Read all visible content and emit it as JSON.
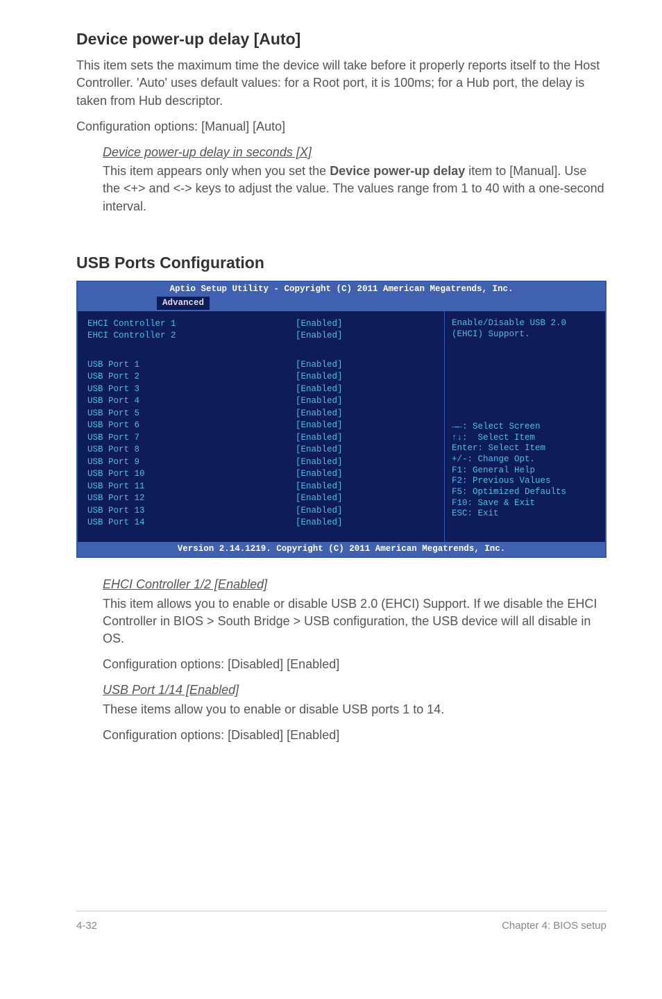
{
  "sections": {
    "device_power_up": {
      "heading": "Device power-up delay [Auto]",
      "para1": "This item sets the maximum time the device will take before it properly reports itself to the Host Controller. 'Auto' uses default values: for a Root port, it is 100ms; for a Hub port, the delay is taken from Hub descriptor.",
      "para2": "Configuration options: [Manual] [Auto]",
      "sub_heading": "Device power-up delay in seconds [X]",
      "sub_para_a": "This item appears only when you set the ",
      "sub_para_bold": "Device power-up delay",
      "sub_para_b": " item to [Manual]. Use the <+> and <-> keys to adjust the value. The values range from 1 to 40 with a one-second interval."
    },
    "usb_ports": {
      "heading": "USB Ports Configuration"
    }
  },
  "bios": {
    "title": "Aptio Setup Utility - Copyright (C) 2011 American Megatrends, Inc.",
    "tab": "Advanced",
    "rows_top": [
      {
        "label": "EHCI Controller 1",
        "value": "[Enabled]"
      },
      {
        "label": "EHCI Controller 2",
        "value": "[Enabled]"
      }
    ],
    "rows_ports": [
      {
        "label": "USB Port 1",
        "value": "[Enabled]"
      },
      {
        "label": "USB Port 2",
        "value": "[Enabled]"
      },
      {
        "label": "USB Port 3",
        "value": "[Enabled]"
      },
      {
        "label": "USB Port 4",
        "value": "[Enabled]"
      },
      {
        "label": "USB Port 5",
        "value": "[Enabled]"
      },
      {
        "label": "USB Port 6",
        "value": "[Enabled]"
      },
      {
        "label": "USB Port 7",
        "value": "[Enabled]"
      },
      {
        "label": "USB Port 8",
        "value": "[Enabled]"
      },
      {
        "label": "USB Port 9",
        "value": "[Enabled]"
      },
      {
        "label": "USB Port 10",
        "value": "[Enabled]"
      },
      {
        "label": "USB Port 11",
        "value": "[Enabled]"
      },
      {
        "label": "USB Port 12",
        "value": "[Enabled]"
      },
      {
        "label": "USB Port 13",
        "value": "[Enabled]"
      },
      {
        "label": "USB Port 14",
        "value": "[Enabled]"
      }
    ],
    "help": "Enable/Disable USB 2.0 (EHCI) Support.",
    "keys": "→←: Select Screen\n↑↓:  Select Item\nEnter: Select Item\n+/-: Change Opt.\nF1: General Help\nF2: Previous Values\nF5: Optimized Defaults\nF10: Save & Exit\nESC: Exit",
    "version": "Version 2.14.1219. Copyright (C) 2011 American Megatrends, Inc."
  },
  "after_bios": {
    "ehci_heading": "EHCI Controller 1/2 [Enabled]",
    "ehci_para": "This item allows you to enable or disable USB 2.0 (EHCI) Support. If we disable the EHCI Controller in BIOS > South Bridge > USB configuration, the USB device will all disable in OS.",
    "config_line": "Configuration options: [Disabled] [Enabled]",
    "usbport_heading": "USB Port 1/14 [Enabled]",
    "usbport_para": "These items allow you to enable or disable USB ports 1 to 14."
  },
  "footer": {
    "left": "4-32",
    "right": "Chapter 4: BIOS setup"
  }
}
